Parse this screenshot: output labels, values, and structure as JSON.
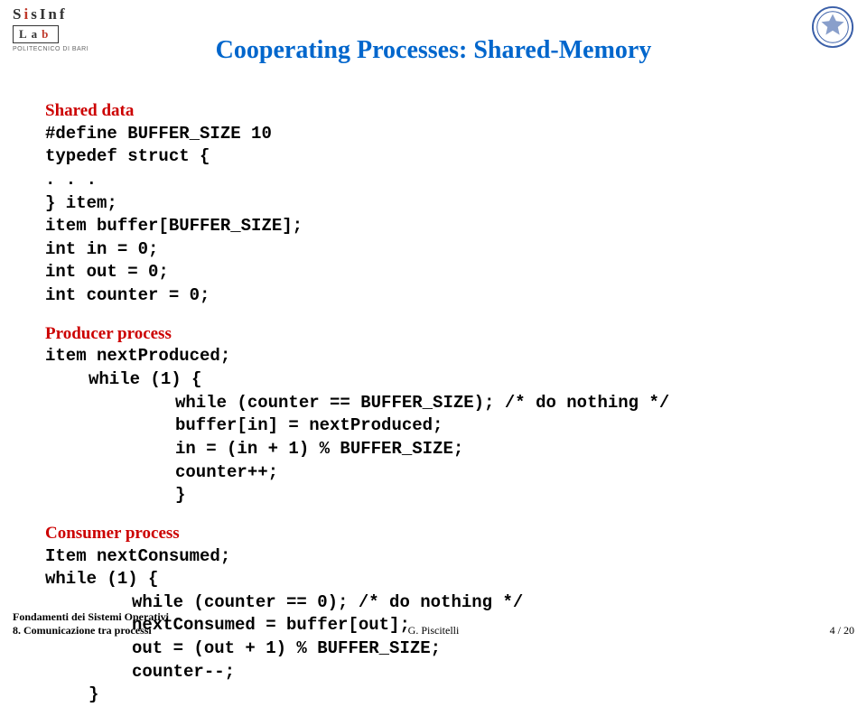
{
  "logos": {
    "sisinflab_brand": "SisInf",
    "lab_word": "Lab",
    "subtitle": "POLITECNICO DI BARI"
  },
  "title": "Cooperating Processes: Shared-Memory",
  "shared_data": {
    "heading": "Shared data",
    "line1": "#define BUFFER_SIZE 10",
    "line2": "typedef struct {",
    "line3": ". . .",
    "line4": "} item;",
    "line5": "item buffer[BUFFER_SIZE];",
    "line6": "int in = 0;",
    "line7": "int out = 0;",
    "line8": "int counter = 0;"
  },
  "producer": {
    "heading": "Producer process",
    "line1": "item nextProduced;",
    "line2": "while (1) {",
    "line3": "while (counter == BUFFER_SIZE); /* do nothing */",
    "line4": "buffer[in] = nextProduced;",
    "line5": "in = (in + 1) % BUFFER_SIZE;",
    "line6": "counter++;",
    "line7": "}"
  },
  "consumer": {
    "heading": "Consumer process",
    "line1": "Item nextConsumed;",
    "line2": "while (1) {",
    "line3": "while (counter == 0); /* do nothing */",
    "line4": "nextConsumed = buffer[out];",
    "line5": "out = (out + 1) % BUFFER_SIZE;",
    "line6": "counter--;",
    "line7": "}"
  },
  "footer": {
    "left1": "Fondamenti dei Sistemi Operativi",
    "left2": "8. Comunicazione tra processi",
    "center": "G. Piscitelli",
    "right": "4 / 20"
  }
}
